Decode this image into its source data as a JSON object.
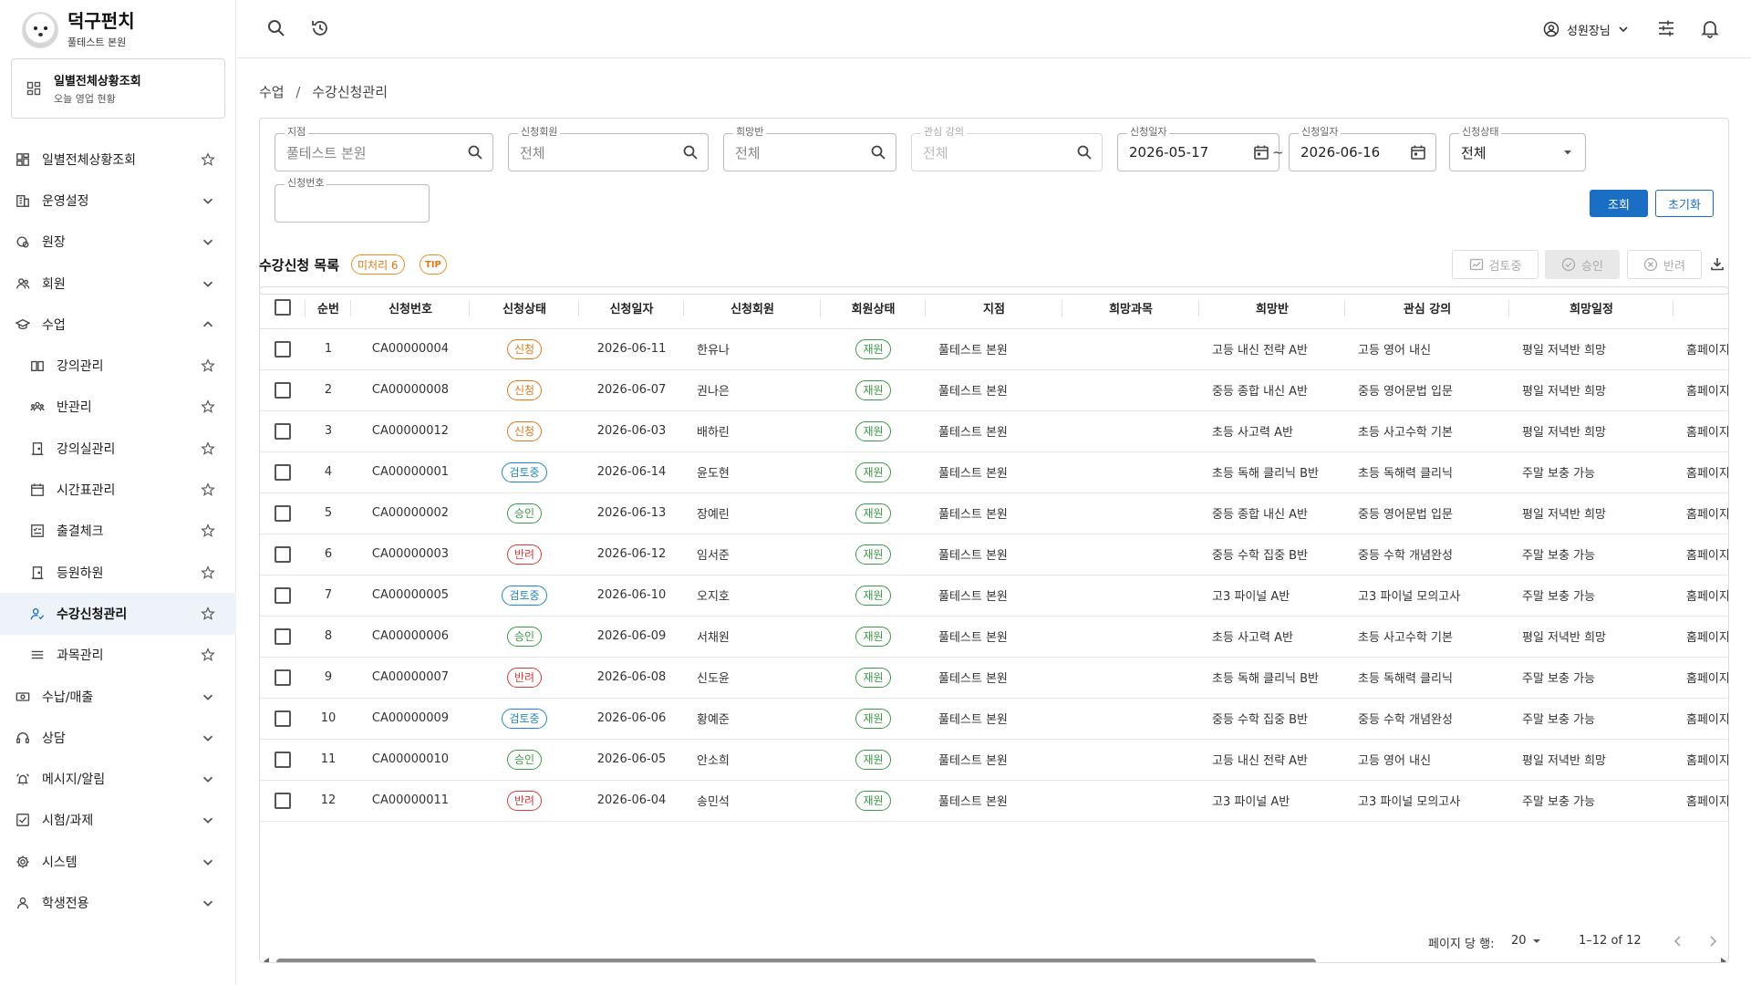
{
  "brand": {
    "name": "덕구펀치",
    "subtitle": "풀테스트 본원"
  },
  "quick_card": {
    "title": "일별전체상황조회",
    "subtitle": "오늘 영업 현황"
  },
  "nav": [
    {
      "label": "일별전체상황조회",
      "icon": "dashboard-icon",
      "right": "star",
      "sub": false,
      "active": false
    },
    {
      "label": "운영설정",
      "icon": "building-icon",
      "right": "chevron-down",
      "sub": false,
      "active": false
    },
    {
      "label": "원장",
      "icon": "ledger-icon",
      "right": "chevron-down",
      "sub": false,
      "active": false
    },
    {
      "label": "회원",
      "icon": "members-icon",
      "right": "chevron-down",
      "sub": false,
      "active": false
    },
    {
      "label": "수업",
      "icon": "graduation-cap-icon",
      "right": "chevron-up",
      "sub": false,
      "active": false
    },
    {
      "label": "강의관리",
      "icon": "book-icon",
      "right": "star",
      "sub": true,
      "active": false
    },
    {
      "label": "반관리",
      "icon": "group-icon",
      "right": "star",
      "sub": true,
      "active": false
    },
    {
      "label": "강의실관리",
      "icon": "door-icon",
      "right": "star",
      "sub": true,
      "active": false
    },
    {
      "label": "시간표관리",
      "icon": "calendar-icon",
      "right": "star",
      "sub": true,
      "active": false
    },
    {
      "label": "출결체크",
      "icon": "checklist-icon",
      "right": "star",
      "sub": true,
      "active": false
    },
    {
      "label": "등원하원",
      "icon": "door-icon",
      "right": "star",
      "sub": true,
      "active": false
    },
    {
      "label": "수강신청관리",
      "icon": "person-check-icon",
      "right": "star",
      "sub": true,
      "active": true
    },
    {
      "label": "과목관리",
      "icon": "list-icon",
      "right": "star",
      "sub": true,
      "active": false
    },
    {
      "label": "수납/매출",
      "icon": "money-icon",
      "right": "chevron-down",
      "sub": false,
      "active": false
    },
    {
      "label": "상담",
      "icon": "headset-icon",
      "right": "chevron-down",
      "sub": false,
      "active": false
    },
    {
      "label": "메시지/알림",
      "icon": "bell-ring-icon",
      "right": "chevron-down",
      "sub": false,
      "active": false
    },
    {
      "label": "시험/과제",
      "icon": "check-square-icon",
      "right": "chevron-down",
      "sub": false,
      "active": false
    },
    {
      "label": "시스템",
      "icon": "gear-icon",
      "right": "chevron-down",
      "sub": false,
      "active": false
    },
    {
      "label": "학생전용",
      "icon": "person-icon",
      "right": "chevron-down",
      "sub": false,
      "active": false
    }
  ],
  "topbar": {
    "user_name": "성원장님"
  },
  "breadcrumb": {
    "parent": "수업",
    "separator": "/",
    "current": "수강신청관리"
  },
  "filters": {
    "branch": {
      "label": "지점",
      "value": "풀테스트 본원"
    },
    "member": {
      "label": "신청회원",
      "value": "전체"
    },
    "class": {
      "label": "희망반",
      "value": "전체"
    },
    "course": {
      "label": "관심 강의",
      "value": "전체"
    },
    "date_from": {
      "label": "신청일자",
      "value": "2026-05-17"
    },
    "tilde": "~",
    "date_to": {
      "label": "신청일자",
      "value": "2026-06-16"
    },
    "status": {
      "label": "신청상태",
      "value": "전체"
    },
    "number": {
      "label": "신청번호",
      "value": ""
    },
    "search_button": "조회",
    "reset_button": "초기화"
  },
  "list": {
    "title": "수강신청 목록",
    "pending_badge": "미처리 6",
    "tip_badge": "TIP",
    "review_button": "검토중",
    "approve_button": "승인",
    "reject_button": "반려"
  },
  "status_colors": {
    "신청": "#e8741a",
    "검토중": "#1e88c8",
    "승인": "#3a9a45",
    "반려": "#d93a3a",
    "재원": "#3a9a45"
  },
  "table": {
    "columns": [
      "",
      "순번",
      "신청번호",
      "신청상태",
      "신청일자",
      "신청회원",
      "회원상태",
      "지점",
      "희망과목",
      "희망반",
      "관심 강의",
      "희망일정",
      ""
    ],
    "rows": [
      [
        "1",
        "CA00000004",
        "신청",
        "2026-06-11",
        "한유나",
        "재원",
        "풀테스트 본원",
        "",
        "고등 내신 전략 A반",
        "고등 영어 내신",
        "평일 저녁반 희망",
        "홈페이지"
      ],
      [
        "2",
        "CA00000008",
        "신청",
        "2026-06-07",
        "권나은",
        "재원",
        "풀테스트 본원",
        "",
        "중등 종합 내신 A반",
        "중등 영어문법 입문",
        "평일 저녁반 희망",
        "홈페이지"
      ],
      [
        "3",
        "CA00000012",
        "신청",
        "2026-06-03",
        "배하린",
        "재원",
        "풀테스트 본원",
        "",
        "초등 사고력 A반",
        "초등 사고수학 기본",
        "평일 저녁반 희망",
        "홈페이지"
      ],
      [
        "4",
        "CA00000001",
        "검토중",
        "2026-06-14",
        "윤도현",
        "재원",
        "풀테스트 본원",
        "",
        "초등 독해 클리닉 B반",
        "초등 독해력 클리닉",
        "주말 보충 가능",
        "홈페이지"
      ],
      [
        "5",
        "CA00000002",
        "승인",
        "2026-06-13",
        "장예린",
        "재원",
        "풀테스트 본원",
        "",
        "중등 종합 내신 A반",
        "중등 영어문법 입문",
        "평일 저녁반 희망",
        "홈페이지"
      ],
      [
        "6",
        "CA00000003",
        "반려",
        "2026-06-12",
        "임서준",
        "재원",
        "풀테스트 본원",
        "",
        "중등 수학 집중 B반",
        "중등 수학 개념완성",
        "주말 보충 가능",
        "홈페이지"
      ],
      [
        "7",
        "CA00000005",
        "검토중",
        "2026-06-10",
        "오지호",
        "재원",
        "풀테스트 본원",
        "",
        "고3 파이널 A반",
        "고3 파이널 모의고사",
        "주말 보충 가능",
        "홈페이지"
      ],
      [
        "8",
        "CA00000006",
        "승인",
        "2026-06-09",
        "서채원",
        "재원",
        "풀테스트 본원",
        "",
        "초등 사고력 A반",
        "초등 사고수학 기본",
        "평일 저녁반 희망",
        "홈페이지"
      ],
      [
        "9",
        "CA00000007",
        "반려",
        "2026-06-08",
        "신도윤",
        "재원",
        "풀테스트 본원",
        "",
        "초등 독해 클리닉 B반",
        "초등 독해력 클리닉",
        "주말 보충 가능",
        "홈페이지"
      ],
      [
        "10",
        "CA00000009",
        "검토중",
        "2026-06-06",
        "황예준",
        "재원",
        "풀테스트 본원",
        "",
        "중등 수학 집중 B반",
        "중등 수학 개념완성",
        "주말 보충 가능",
        "홈페이지"
      ],
      [
        "11",
        "CA00000010",
        "승인",
        "2026-06-05",
        "안소희",
        "재원",
        "풀테스트 본원",
        "",
        "고등 내신 전략 A반",
        "고등 영어 내신",
        "평일 저녁반 희망",
        "홈페이지"
      ],
      [
        "12",
        "CA00000011",
        "반려",
        "2026-06-04",
        "송민석",
        "재원",
        "풀테스트 본원",
        "",
        "고3 파이널 A반",
        "고3 파이널 모의고사",
        "주말 보충 가능",
        "홈페이지"
      ]
    ]
  },
  "pagination": {
    "rows_per_page_label": "페이지 당 행:",
    "rows_per_page": "20",
    "range": "1–12 of 12"
  }
}
